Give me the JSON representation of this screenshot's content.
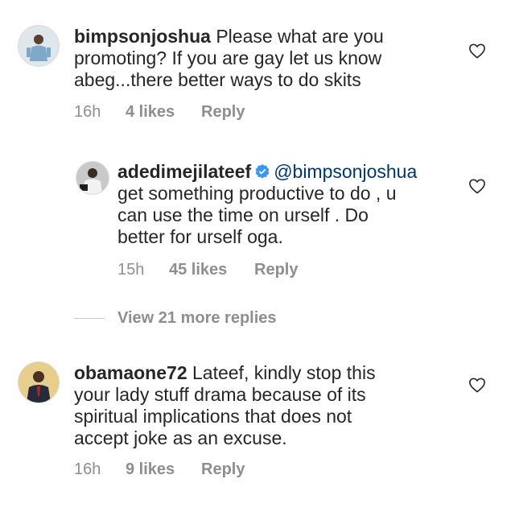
{
  "comments": [
    {
      "username": "bimpsonjoshua",
      "text_lines": [
        "Please what are you",
        "promoting? If you are gay let us know",
        "abeg...there better ways to do skits"
      ],
      "time": "16h",
      "likes": "4 likes",
      "reply_label": "Reply"
    },
    {
      "username": "adedimejilateef",
      "verified": true,
      "mention": "@bimpsonjoshua",
      "text_lines": [
        "get something productive to do , u",
        "can use the time on urself . Do",
        "better for urself oga."
      ],
      "time": "15h",
      "likes": "45 likes",
      "reply_label": "Reply"
    },
    {
      "username": "obamaone72",
      "text_lines": [
        "Lateef, kindly stop this",
        "your lady stuff drama because of its",
        "spiritual implications that does not",
        "accept joke as an excuse."
      ],
      "time": "16h",
      "likes": "9 likes",
      "reply_label": "Reply"
    }
  ],
  "view_more": "View 21 more replies",
  "colors": {
    "text": "#262626",
    "meta": "#8e8e8e",
    "mention": "#00376b",
    "verified": "#3897f0"
  }
}
